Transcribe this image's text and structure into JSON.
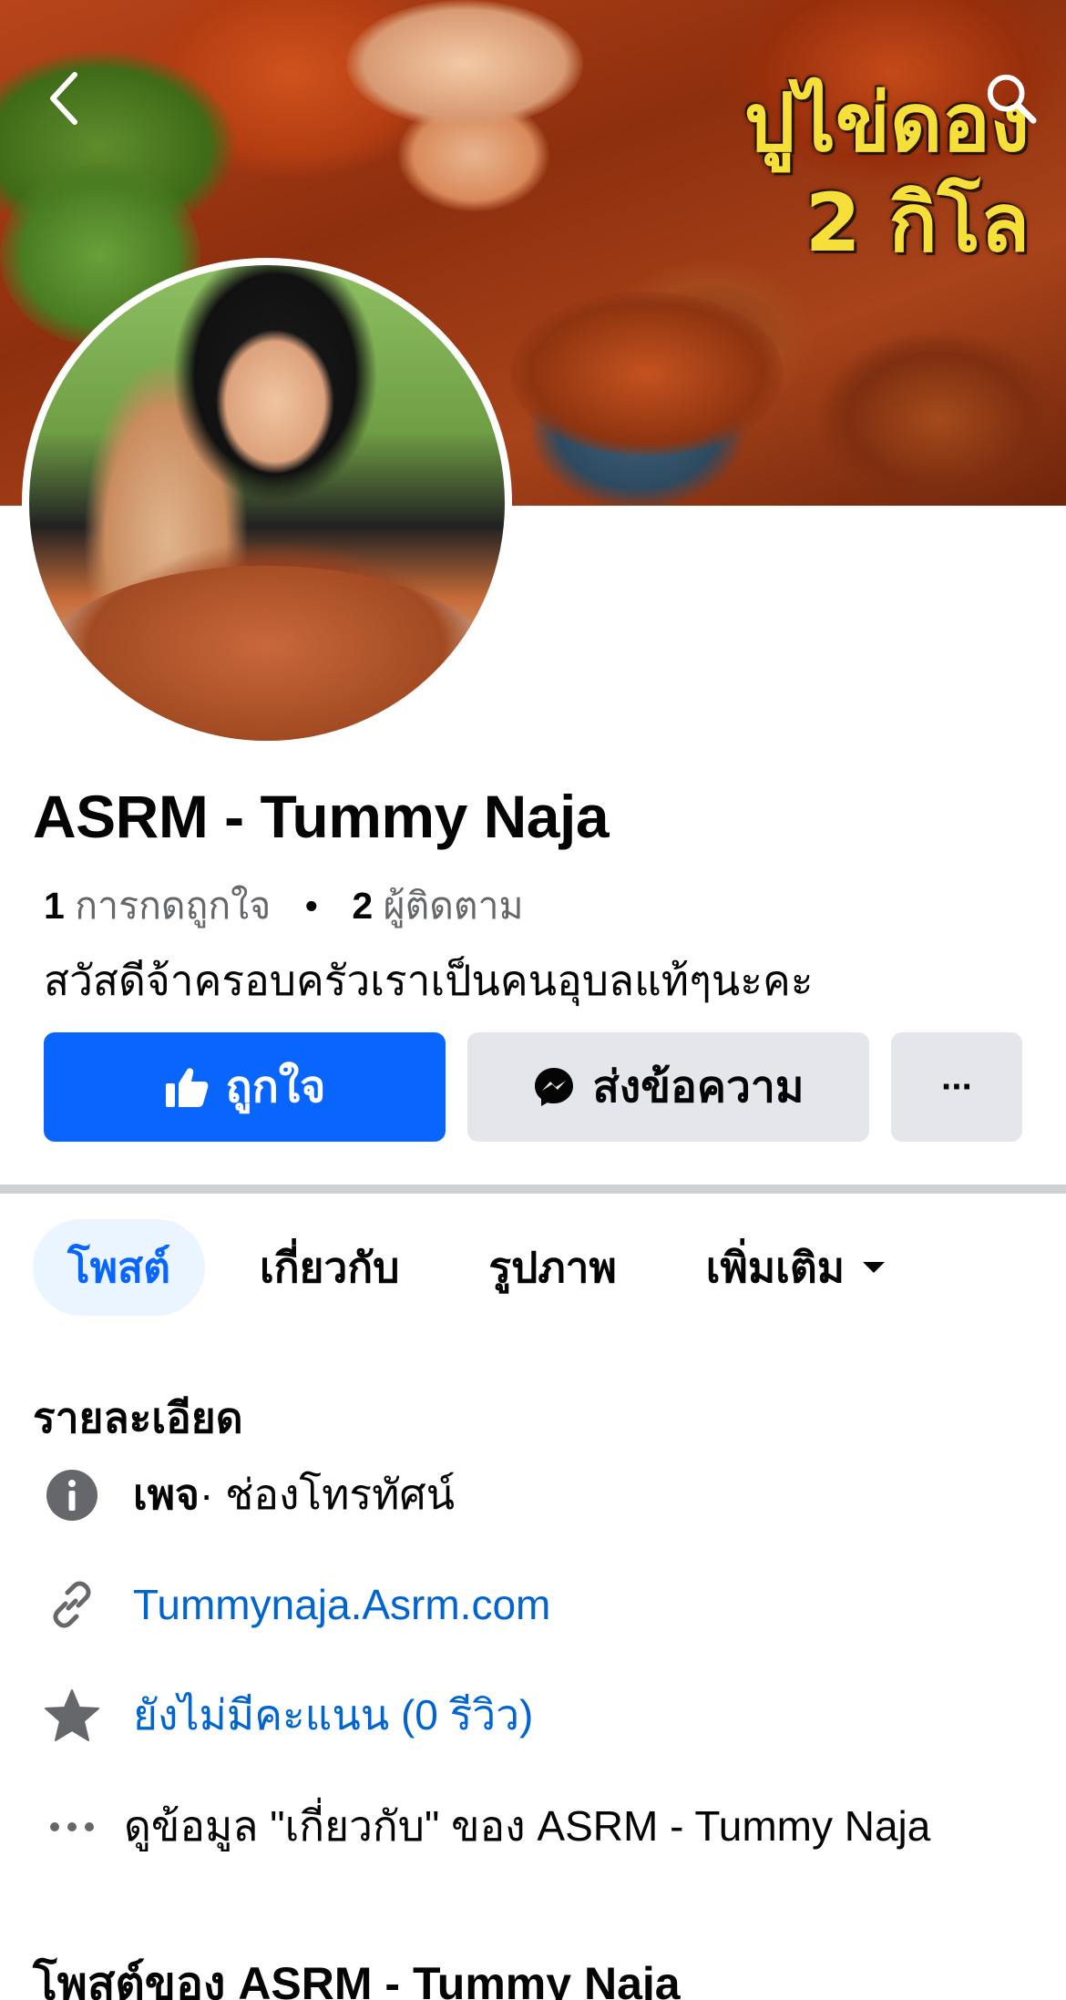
{
  "cover": {
    "overlay_line1": "ปูไข่ดอง",
    "overlay_line2": "2 กิโล"
  },
  "icons": {
    "back": "chevron-left-icon",
    "search": "search-icon",
    "like": "thumbs-up-icon",
    "messenger": "messenger-icon",
    "more": "ellipsis-icon",
    "info": "info-icon",
    "link": "link-icon",
    "rating": "star-icon",
    "about": "ellipsis-icon",
    "tab_more": "caret-down-icon"
  },
  "profile": {
    "name": "ASRM - Tummy Naja",
    "likes_count": "1",
    "likes_label": "การกดถูกใจ",
    "followers_count": "2",
    "followers_label": "ผู้ติดตาม",
    "bio": "สวัสดีจ้าครอบครัวเราเป็นคนอุบลแท้ๆนะคะ"
  },
  "actions": {
    "like_label": "ถูกใจ",
    "message_label": "ส่งข้อความ",
    "more_label": "···"
  },
  "tabs": [
    {
      "label": "โพสต์",
      "active": true
    },
    {
      "label": "เกี่ยวกับ",
      "active": false
    },
    {
      "label": "รูปภาพ",
      "active": false
    },
    {
      "label": "เพิ่มเติม",
      "active": false
    }
  ],
  "details": {
    "title": "รายละเอียด",
    "category_prefix": "เพจ",
    "category": " · ช่องโทรทัศน์",
    "website": "Tummynaja.Asrm.com",
    "rating": "ยังไม่มีคะแนน (0 รีวิว)",
    "about_link": "ดูข้อมูล \"เกี่ยวกับ\" ของ ASRM - Tummy Naja"
  },
  "posts": {
    "title": "โพสต์ของ ASRM - Tummy Naja"
  },
  "colors": {
    "accent": "#0866ff",
    "link": "#0064d1",
    "secondary_button": "#e4e6eb",
    "active_tab_bg": "#ebf5ff",
    "muted_text": "#65676b"
  }
}
